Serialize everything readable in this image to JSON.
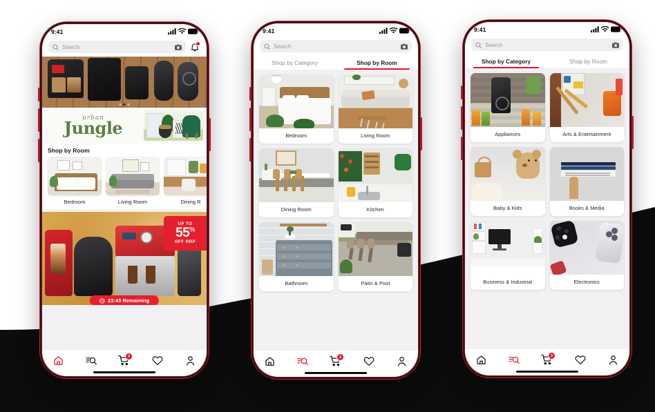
{
  "scene": {
    "background_color": "#ffffff",
    "band_color": "#0c0c0c",
    "brand_color": "#e8142d"
  },
  "phones": [
    {
      "id": "phone-home",
      "status_bar": {
        "time": "9:41",
        "signal_icon": "cellular-bars-icon",
        "wifi_icon": "wifi-icon",
        "battery_icon": "battery-icon"
      },
      "search": {
        "placeholder": "Search",
        "search_icon": "search-icon",
        "camera_icon": "camera-icon",
        "bell_icon": "bell-icon",
        "has_notification": true
      },
      "hero": {
        "name": "coffee-machines-carousel",
        "dots": 3,
        "active_dot": 2
      },
      "banner": {
        "script_word": "urban",
        "main_word": "Jungle",
        "image_name": "green-armchair-plants-banner"
      },
      "section_title": "Shop by Room",
      "rooms": [
        {
          "label": "Bedroom",
          "image_name": "bedroom-thumb"
        },
        {
          "label": "Living Room",
          "image_name": "living-room-thumb"
        },
        {
          "label": "Dining R",
          "image_name": "dining-room-thumb"
        }
      ],
      "promo": {
        "up_to": "UP TO",
        "percent": "55",
        "percent_symbol": "%",
        "off_text": "OFF RRP",
        "countdown": "23:43 Remaining",
        "clock_icon": "clock-icon",
        "image_name": "espresso-machines-promo"
      },
      "nav": {
        "active": "home",
        "items": [
          {
            "name": "home",
            "icon": "home-icon",
            "label": "Home"
          },
          {
            "name": "browse",
            "icon": "browse-search-icon",
            "label": "Browse"
          },
          {
            "name": "cart",
            "icon": "cart-icon",
            "label": "Cart",
            "badge": "3"
          },
          {
            "name": "wishlist",
            "icon": "heart-icon",
            "label": "Wishlist"
          },
          {
            "name": "account",
            "icon": "person-icon",
            "label": "Account"
          }
        ]
      }
    },
    {
      "id": "phone-shop-by-room",
      "status_bar": {
        "time": "9:41",
        "signal_icon": "cellular-bars-icon",
        "wifi_icon": "wifi-icon",
        "battery_icon": "battery-icon"
      },
      "search": {
        "placeholder": "Search",
        "search_icon": "search-icon",
        "camera_icon": "camera-icon",
        "bell_icon": null,
        "has_notification": false
      },
      "tabs": [
        {
          "label": "Shop by Category",
          "active": false
        },
        {
          "label": "Shop by Room",
          "active": true
        }
      ],
      "tiles": [
        {
          "label": "Bedroom",
          "image_name": "bedroom-tile"
        },
        {
          "label": "Living Room",
          "image_name": "living-room-tile"
        },
        {
          "label": "Dining Room",
          "image_name": "dining-room-tile"
        },
        {
          "label": "Kitchen",
          "image_name": "kitchen-tile"
        },
        {
          "label": "Bathroom",
          "image_name": "bathroom-tile"
        },
        {
          "label": "Patio & Pool",
          "image_name": "patio-pool-tile"
        }
      ],
      "nav": {
        "active": "browse",
        "items": [
          {
            "name": "home",
            "icon": "home-icon",
            "label": "Home"
          },
          {
            "name": "browse",
            "icon": "browse-search-icon",
            "label": "Browse"
          },
          {
            "name": "cart",
            "icon": "cart-icon",
            "label": "Cart",
            "badge": "3"
          },
          {
            "name": "wishlist",
            "icon": "heart-icon",
            "label": "Wishlist"
          },
          {
            "name": "account",
            "icon": "person-icon",
            "label": "Account"
          }
        ]
      }
    },
    {
      "id": "phone-shop-by-category",
      "status_bar": {
        "time": "9:41",
        "signal_icon": "cellular-bars-icon",
        "wifi_icon": "wifi-icon",
        "battery_icon": "battery-icon"
      },
      "search": {
        "placeholder": "Search",
        "search_icon": "search-icon",
        "camera_icon": "camera-icon",
        "bell_icon": null,
        "has_notification": false
      },
      "tabs": [
        {
          "label": "Shop by Category",
          "active": true
        },
        {
          "label": "Shop by Room",
          "active": false
        }
      ],
      "tiles": [
        {
          "label": "Appliances",
          "image_name": "appliances-tile"
        },
        {
          "label": "Arts & Entertainment",
          "image_name": "arts-entertainment-tile"
        },
        {
          "label": "Baby & Kids",
          "image_name": "baby-kids-tile"
        },
        {
          "label": "Books & Media",
          "image_name": "books-media-tile"
        },
        {
          "label": "Business & Industrial",
          "image_name": "business-industrial-tile"
        },
        {
          "label": "Electronics",
          "image_name": "electronics-tile"
        }
      ],
      "nav": {
        "active": "browse",
        "items": [
          {
            "name": "home",
            "icon": "home-icon",
            "label": "Home"
          },
          {
            "name": "browse",
            "icon": "browse-search-icon",
            "label": "Browse"
          },
          {
            "name": "cart",
            "icon": "cart-icon",
            "label": "Cart",
            "badge": "3"
          },
          {
            "name": "wishlist",
            "icon": "heart-icon",
            "label": "Wishlist"
          },
          {
            "name": "account",
            "icon": "person-icon",
            "label": "Account"
          }
        ]
      }
    }
  ]
}
